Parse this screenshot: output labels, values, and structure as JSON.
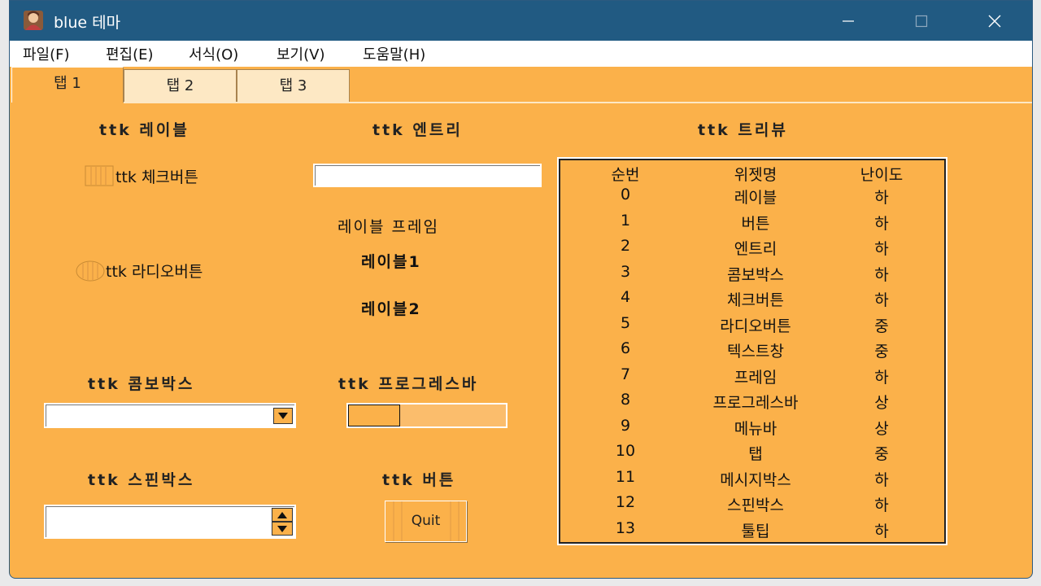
{
  "window": {
    "title": "blue 테마",
    "controls": {
      "minimize": "—",
      "maximize": "☐",
      "close": "✕"
    }
  },
  "menu": [
    "파일(F)",
    "편집(E)",
    "서식(O)",
    "보기(V)",
    "도움말(H)"
  ],
  "tabs": [
    "탭 1",
    "탭 2",
    "탭 3"
  ],
  "left": {
    "label_heading": "ttk 레이블",
    "checkbutton": "ttk 체크버튼",
    "radiobutton": "ttk 라디오버튼",
    "combobox_heading": "ttk 콤보박스",
    "combobox_value": "",
    "spinbox_heading": "ttk 스핀박스",
    "spinbox_value": ""
  },
  "middle": {
    "entry_heading": "ttk 엔트리",
    "entry_value": "",
    "frame_label": "레이블 프레임",
    "label1": "레이블1",
    "label2": "레이블2",
    "progress_heading": "ttk 프로그레스바",
    "progress_value": 0.33,
    "button_heading": "ttk 버튼",
    "quit_button": "Quit"
  },
  "treeview": {
    "heading": "ttk 트리뷰",
    "columns": [
      "순번",
      "위젯명",
      "난이도"
    ],
    "rows": [
      [
        "0",
        "레이블",
        "하"
      ],
      [
        "1",
        "버튼",
        "하"
      ],
      [
        "2",
        "엔트리",
        "하"
      ],
      [
        "3",
        "콤보박스",
        "하"
      ],
      [
        "4",
        "체크버튼",
        "하"
      ],
      [
        "5",
        "라디오버튼",
        "중"
      ],
      [
        "6",
        "텍스트창",
        "중"
      ],
      [
        "7",
        "프레임",
        "하"
      ],
      [
        "8",
        "프로그레스바",
        "상"
      ],
      [
        "9",
        "메뉴바",
        "상"
      ],
      [
        "10",
        "탭",
        "중"
      ],
      [
        "11",
        "메시지박스",
        "하"
      ],
      [
        "12",
        "스핀박스",
        "하"
      ],
      [
        "13",
        "툴팁",
        "하"
      ]
    ]
  },
  "colors": {
    "titlebar": "#215a82",
    "theme": "#fbb14a"
  }
}
